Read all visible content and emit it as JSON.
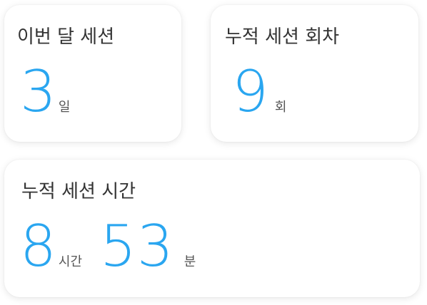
{
  "cards": {
    "monthly_sessions": {
      "title": "이번 달 세션",
      "value": "3",
      "unit": "일"
    },
    "total_session_count": {
      "title": "누적 세션 회차",
      "value": "9",
      "unit": "회"
    },
    "total_session_time": {
      "title": "누적 세션 시간",
      "hours_value": "8",
      "hours_unit": "시간",
      "minutes_value": "53",
      "minutes_unit": "분"
    }
  },
  "colors": {
    "accent": "#2aa6f0",
    "text": "#333333",
    "card_background": "#ffffff"
  }
}
